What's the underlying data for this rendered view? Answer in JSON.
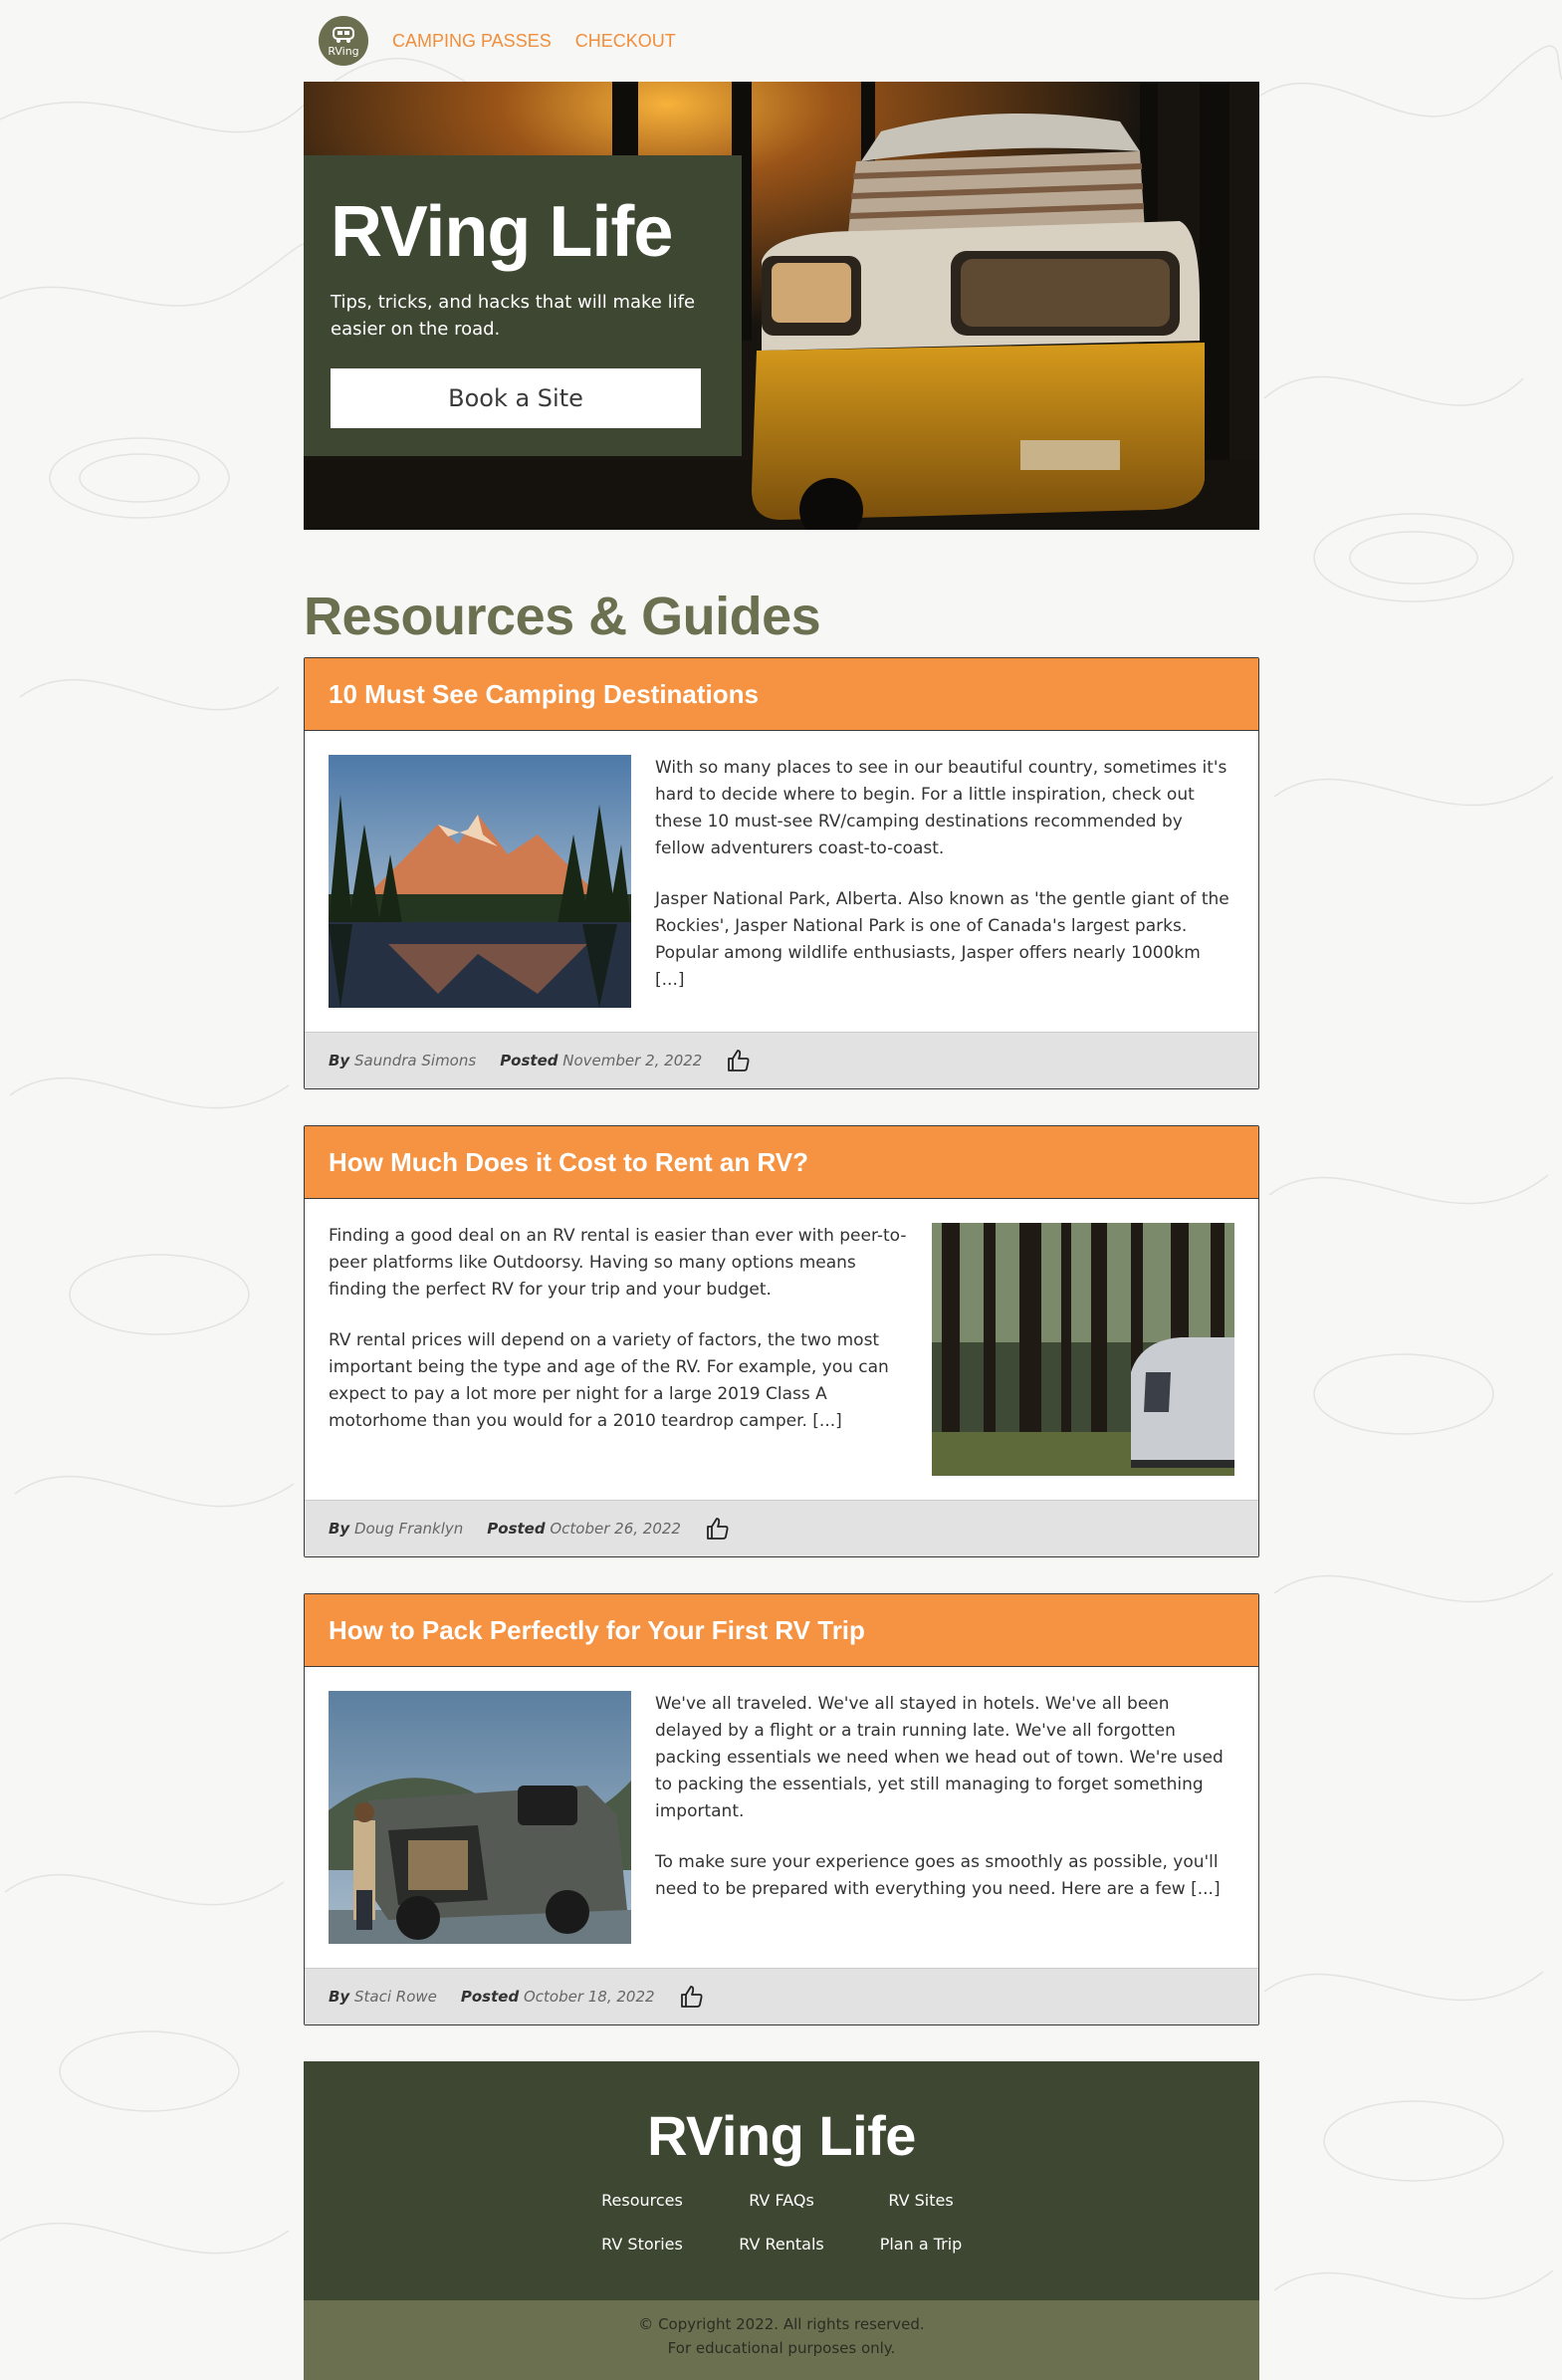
{
  "colors": {
    "accent": "#f59342",
    "nav_link": "#f08e3c",
    "dark_green": "#3d4731",
    "olive": "#6b7150",
    "footer_bar": "#6b7150"
  },
  "nav": {
    "logo_text": "RVing",
    "links": [
      "CAMPING PASSES",
      "CHECKOUT"
    ]
  },
  "hero": {
    "title": "RVing Life",
    "subtitle": "Tips, tricks, and hacks that will make life easier on the road.",
    "button": "Book a Site"
  },
  "resources": {
    "title": "Resources & Guides",
    "posts": [
      {
        "title": "10 Must See Camping Destinations",
        "paragraphs": [
          "With so many places to see in our beautiful country, sometimes it's hard to decide where to begin. For a little inspiration, check out these 10 must-see RV/camping destinations recommended by fellow adventurers coast-to-coast.",
          "Jasper National Park, Alberta. Also known as 'the gentle giant of the Rockies', Jasper National Park is one of Canada's largest parks. Popular among wildlife enthusiasts, Jasper offers nearly 1000km [...]"
        ],
        "by_label": "By",
        "author": "Saundra Simons",
        "posted_label": "Posted",
        "date": "November 2, 2022"
      },
      {
        "title": "How Much Does it Cost to Rent an RV?",
        "paragraphs": [
          "Finding a good deal on an RV rental is easier than ever with peer-to-peer platforms like Outdoorsy. Having so many options means finding the perfect RV for your trip and your budget.",
          "RV rental prices will depend on a variety of factors, the two most important being the type and age of the RV. For example, you can expect to pay a lot more per night for a large 2019 Class A motorhome than you would for a 2010 teardrop camper. [...]"
        ],
        "by_label": "By",
        "author": "Doug Franklyn",
        "posted_label": "Posted",
        "date": "October 26, 2022"
      },
      {
        "title": "How to Pack Perfectly for Your First RV Trip",
        "paragraphs": [
          "We've all traveled. We've all stayed in hotels. We've all been delayed by a flight or a train running late. We've all forgotten packing essentials we need when we head out of town. We're used to packing the essentials, yet still managing to forget something important.",
          "To make sure your experience goes as smoothly as possible, you'll need to be prepared with everything you need. Here are a few [...]"
        ],
        "by_label": "By",
        "author": "Staci Rowe",
        "posted_label": "Posted",
        "date": "October 18, 2022"
      }
    ]
  },
  "footer": {
    "title": "RVing Life",
    "links": [
      "Resources",
      "RV FAQs",
      "RV Sites",
      "RV Stories",
      "RV Rentals",
      "Plan a Trip"
    ],
    "copyright": "© Copyright 2022. All rights reserved.",
    "note": "For educational purposes only."
  }
}
